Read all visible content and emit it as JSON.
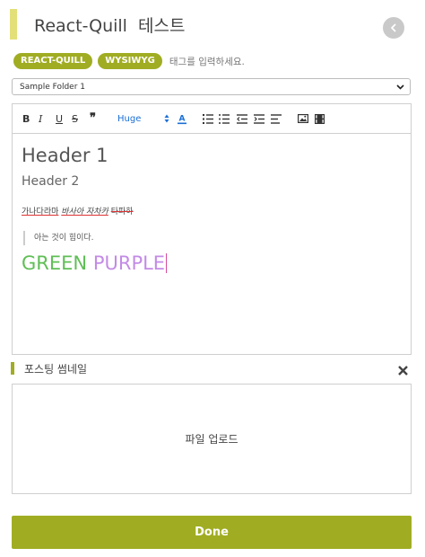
{
  "header": {
    "title": "React-Quill  테스트"
  },
  "tags": {
    "items": [
      "REACT-QUILL",
      "WYSIWYG"
    ],
    "placeholder": "태그를 입력하세요."
  },
  "folder_select": {
    "value": "Sample Folder 1"
  },
  "toolbar": {
    "size_label": "Huge",
    "color_letter": "A"
  },
  "content": {
    "h1": "Header 1",
    "h2": "Header 2",
    "underline_text": "가나다라마",
    "italic_text": "바사아 자차카",
    "strike_text": "타파하",
    "quote": "아는 것이 힘이다.",
    "green_word": "GREEN",
    "purple_word": "PURPLE"
  },
  "thumbnail": {
    "label": "포스팅 썸네일",
    "upload_label": "파일 업로드"
  },
  "footer": {
    "done_label": "Done"
  },
  "colors": {
    "accent": "#a0ad23",
    "title_bar": "#e3e07a",
    "green": "#5fbf55",
    "purple": "#c38be6",
    "link_blue": "#1a6fd6"
  }
}
